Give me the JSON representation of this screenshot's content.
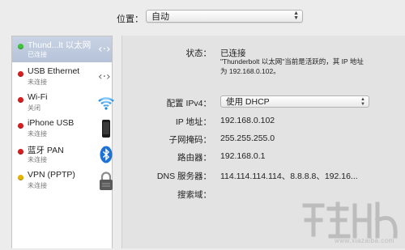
{
  "location": {
    "label": "位置：",
    "value": "自动"
  },
  "sidebar": {
    "items": [
      {
        "name": "Thund...lt 以太网",
        "status": "已连接",
        "dot_color": "#3ec43e",
        "icon": "ethernet-arrows-icon",
        "selected": true
      },
      {
        "name": "USB Ethernet",
        "status": "未连接",
        "dot_color": "#d81e1e",
        "icon": "ethernet-arrows-icon",
        "selected": false
      },
      {
        "name": "Wi-Fi",
        "status": "关闭",
        "dot_color": "#d81e1e",
        "icon": "wifi-icon",
        "selected": false
      },
      {
        "name": "iPhone USB",
        "status": "未连接",
        "dot_color": "#d81e1e",
        "icon": "iphone-icon",
        "selected": false
      },
      {
        "name": "蓝牙 PAN",
        "status": "未连接",
        "dot_color": "#d81e1e",
        "icon": "bluetooth-icon",
        "selected": false
      },
      {
        "name": "VPN (PPTP)",
        "status": "未连接",
        "dot_color": "#e8b400",
        "icon": "lock-icon",
        "selected": false
      }
    ]
  },
  "details": {
    "status_label": "状态：",
    "status_value": "已连接",
    "status_desc_line1": "\"Thunderbolt 以太网\"当前是活跃的，其 IP 地址",
    "status_desc_line2": "为 192.168.0.102。",
    "ipv4_label": "配置 IPv4：",
    "ipv4_value": "使用 DHCP",
    "ip_label": "IP 地址：",
    "ip_value": "192.168.0.102",
    "mask_label": "子网掩码：",
    "mask_value": "255.255.255.0",
    "router_label": "路由器：",
    "router_value": "192.168.0.1",
    "dns_label": "DNS 服务器：",
    "dns_value": "114.114.114.114、8.8.8.8、192.16...",
    "search_label": "搜索域："
  },
  "watermark": {
    "url": "www.xiazaiba.com"
  },
  "colors": {
    "selected_bg": "#bcc8dc",
    "panel_bg": "#e3e3e3"
  }
}
